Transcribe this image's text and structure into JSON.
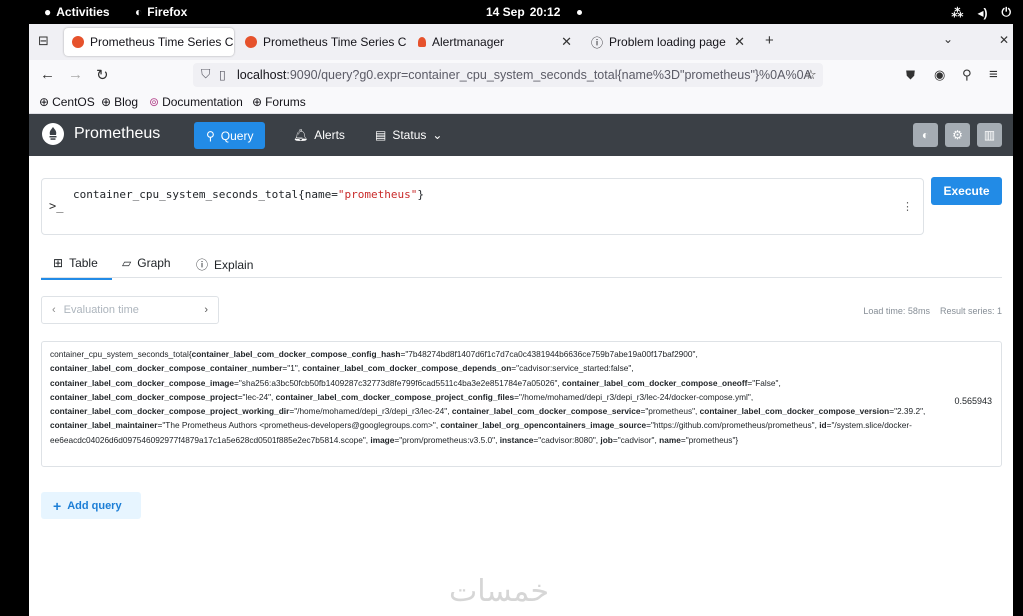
{
  "system_bar": {
    "activities": "Activities",
    "app": "Firefox",
    "date": "14 Sep",
    "time": "20:12"
  },
  "browser": {
    "tabs": [
      {
        "title": "Prometheus Time Series C",
        "active": true
      },
      {
        "title": "Prometheus Time Series C",
        "active": false
      },
      {
        "title": "Alertmanager",
        "active": false
      },
      {
        "title": "Problem loading page",
        "active": false
      }
    ],
    "url": {
      "host": "localhost",
      "rest": ":9090/query?g0.expr=container_cpu_system_seconds_total{name%3D\"prometheus\"}%0A%0A"
    },
    "bookmarks": [
      "CentOS",
      "Blog",
      "Documentation",
      "Forums"
    ]
  },
  "app": {
    "brand": "Prometheus",
    "nav": {
      "query": "Query",
      "alerts": "Alerts",
      "status": "Status"
    },
    "query": {
      "metric": "container_cpu_system_seconds_total",
      "label_key": "name",
      "label_value": "\"prometheus\""
    },
    "execute": "Execute",
    "tabs": {
      "table": "Table",
      "graph": "Graph",
      "explain": "Explain"
    },
    "eval_placeholder": "Evaluation time",
    "load_time": "Load time: 58ms",
    "result_series": "Result series: 1",
    "result": {
      "metric": "container_cpu_system_seconds_total",
      "value": "0.565943",
      "labels": [
        {
          "k": "container_label_com_docker_compose_config_hash",
          "v": "\"7b48274bd8f1407d6f1c7d7ca0c4381944b6636ce759b7abe19a00f17baf2900\""
        },
        {
          "k": "container_label_com_docker_compose_container_number",
          "v": "\"1\""
        },
        {
          "k": "container_label_com_docker_compose_depends_on",
          "v": "\"cadvisor:service_started:false\""
        },
        {
          "k": "container_label_com_docker_compose_image",
          "v": "\"sha256:a3bc50fcb50fb1409287c32773d8fe799f6cad5511c4ba3e2e851784e7a05026\""
        },
        {
          "k": "container_label_com_docker_compose_oneoff",
          "v": "\"False\""
        },
        {
          "k": "container_label_com_docker_compose_project",
          "v": "\"lec-24\""
        },
        {
          "k": "container_label_com_docker_compose_project_config_files",
          "v": "\"/home/mohamed/depi_r3/depi_r3/lec-24/docker-compose.yml\""
        },
        {
          "k": "container_label_com_docker_compose_project_working_dir",
          "v": "\"/home/mohamed/depi_r3/depi_r3/lec-24\""
        },
        {
          "k": "container_label_com_docker_compose_service",
          "v": "\"prometheus\""
        },
        {
          "k": "container_label_com_docker_compose_version",
          "v": "\"2.39.2\""
        },
        {
          "k": "container_label_maintainer",
          "v": "\"The Prometheus Authors <prometheus-developers@googlegroups.com>\""
        },
        {
          "k": "container_label_org_opencontainers_image_source",
          "v": "\"https://github.com/prometheus/prometheus\""
        },
        {
          "k": "id",
          "v": "\"/system.slice/docker-ee6eacdc04026d6d097546092977f4879a17c1a5e628cd0501f885e2ec7b5814.scope\""
        },
        {
          "k": "image",
          "v": "\"prom/prometheus:v3.5.0\""
        },
        {
          "k": "instance",
          "v": "\"cadvisor:8080\""
        },
        {
          "k": "job",
          "v": "\"cadvisor\""
        },
        {
          "k": "name",
          "v": "\"prometheus\""
        }
      ]
    },
    "add_query": "Add query"
  },
  "watermark": "خمسات",
  "colors": {
    "accent": "#228be6",
    "navbar": "#3b4046",
    "string": "#c92a2a"
  }
}
